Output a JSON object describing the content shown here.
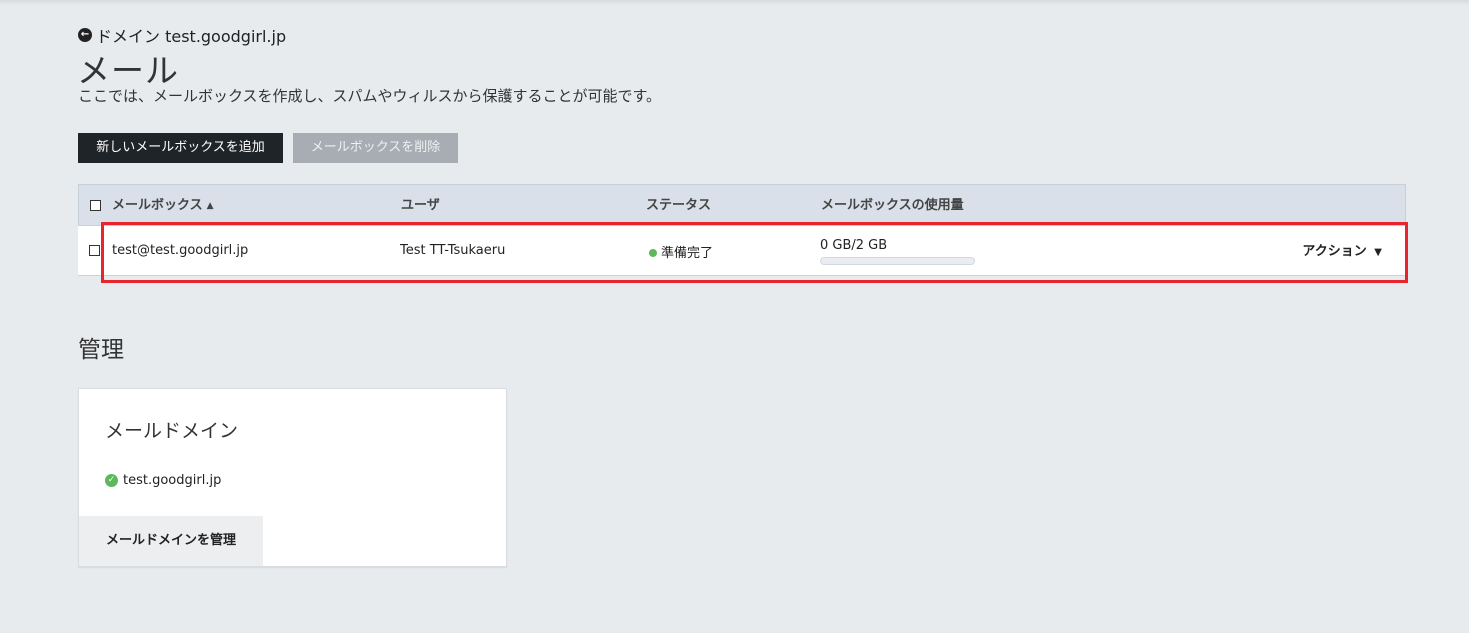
{
  "header": {
    "back_link": "ドメイン test.goodgirl.jp",
    "title": "メール",
    "description": "ここでは、メールボックスを作成し、スパムやウィルスから保護することが可能です。"
  },
  "toolbar": {
    "add_mailbox_label": "新しいメールボックスを追加",
    "delete_mailbox_label": "メールボックスを削除"
  },
  "table": {
    "columns": [
      "メールボックス",
      "ユーザ",
      "ステータス",
      "メールボックスの使用量"
    ],
    "sort_icon": "caret-up-icon",
    "rows": [
      {
        "mailbox": "test@test.goodgirl.jp",
        "user": "Test TT-Tsukaeru",
        "status": "準備完了",
        "status_color": "#5cb85c",
        "usage": "0 GB/2 GB",
        "usage_fraction": 0,
        "action_label": "アクション"
      }
    ]
  },
  "management": {
    "section_title": "管理",
    "card": {
      "title": "メールドメイン",
      "domain": "test.goodgirl.jp",
      "button_label": "メールドメインを管理"
    }
  },
  "colors": {
    "highlight": "#e8242c",
    "primary_button": "#1f2428",
    "success": "#5cb85c"
  }
}
